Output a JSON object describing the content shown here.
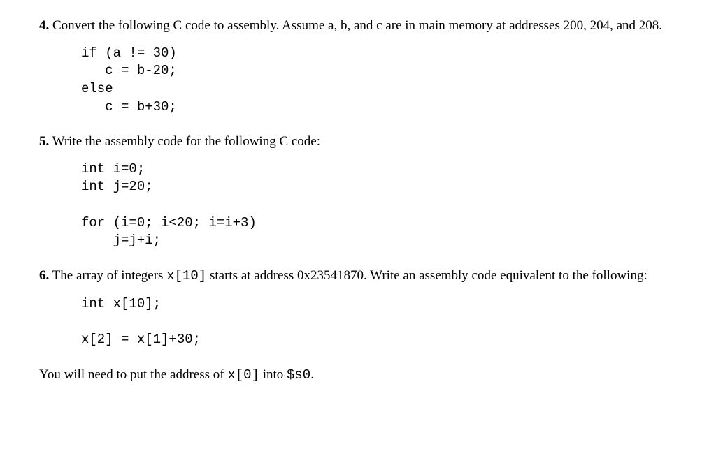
{
  "q4": {
    "number": "4.",
    "text_part1": " Convert the following C code to assembly. Assume a, b, and c are in main memory at addresses 200, 204, and 208.",
    "code": "if (a != 30)\n   c = b-20;\nelse\n   c = b+30;"
  },
  "q5": {
    "number": "5.",
    "text": " Write the assembly code for the following C code:",
    "code": "int i=0;\nint j=20;\n\nfor (i=0; i<20; i=i+3)\n    j=j+i;"
  },
  "q6": {
    "number": "6.",
    "text_part1": " The array of integers ",
    "code_inline1": "x[10]",
    "text_part2": " starts at address 0x23541870. Write an assembly code equivalent to the following:",
    "code": "int x[10];\n\nx[2] = x[1]+30;",
    "closing_part1": "You will need to put the address of ",
    "closing_code1": "x[0]",
    "closing_part2": " into ",
    "closing_code2": "$s0",
    "closing_part3": "."
  }
}
